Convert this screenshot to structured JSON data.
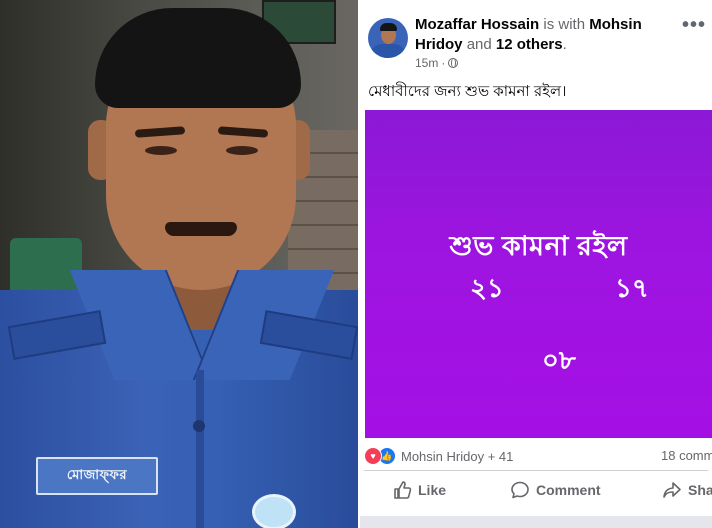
{
  "photo": {
    "nameplate_text": "মোজাফ্ফর"
  },
  "post": {
    "author": "Mozaffar Hossain",
    "with_text": "is with",
    "tagged": "Mohsin Hridoy",
    "and_text": "and",
    "others": "12 others",
    "period": ".",
    "time": "15m",
    "dot": "·",
    "more_icon": "more-options-icon",
    "caption": "মেধাবীদের জন্য শুভ কামনা রইল।",
    "card": {
      "background": "#9b15de",
      "title": "শুভ কামনা রইল",
      "number_1": "২১",
      "number_2": "১৭",
      "number_3": "০৮"
    },
    "reactions": {
      "icons": [
        "love-icon",
        "like-icon"
      ],
      "text": "Mohsin Hridoy + 41",
      "comments": "18 comm"
    },
    "actions": {
      "like": "Like",
      "comment": "Comment",
      "share": "Shar"
    }
  },
  "colors": {
    "facebook_blue": "#1877f2",
    "love_red": "#f33e58",
    "secondary_text": "#65676b"
  }
}
